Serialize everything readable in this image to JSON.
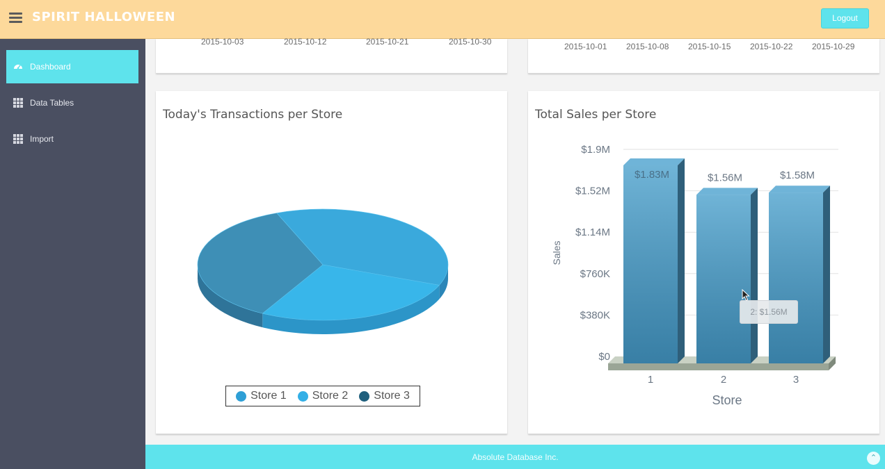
{
  "header": {
    "brand": "SPIRIT HALLOWEEN",
    "logout_label": "Logout"
  },
  "sidebar": {
    "items": [
      {
        "label": "Dashboard",
        "icon": "dashboard-icon",
        "active": true
      },
      {
        "label": "Data Tables",
        "icon": "grid-icon",
        "active": false
      },
      {
        "label": "Import",
        "icon": "grid-icon",
        "active": false
      }
    ]
  },
  "top_left_card": {
    "x_ticks": [
      "2015-10-03",
      "2015-10-12",
      "2015-10-21",
      "2015-10-30"
    ]
  },
  "top_right_card": {
    "x_ticks": [
      "2015-10-01",
      "2015-10-08",
      "2015-10-15",
      "2015-10-22",
      "2015-10-29"
    ]
  },
  "chart_data": [
    {
      "type": "pie",
      "title": "Today's Transactions per Store",
      "categories": [
        "Store 1",
        "Store 2",
        "Store 3"
      ],
      "values": [
        37,
        27,
        36
      ],
      "colors": [
        "#2e9fd6",
        "#33afe6",
        "#3a8fb8"
      ],
      "legend": "bottom"
    },
    {
      "type": "bar",
      "title": "Total Sales per Store",
      "categories": [
        "1",
        "2",
        "3"
      ],
      "values": [
        1830000,
        1560000,
        1580000
      ],
      "data_labels": [
        "$1.83M",
        "$1.56M",
        "$1.58M"
      ],
      "xlabel": "Store",
      "ylabel": "Sales",
      "y_ticks": [
        "$0",
        "$380K",
        "$760K",
        "$1.14M",
        "$1.52M",
        "$1.9M"
      ],
      "ylim": [
        0,
        1900000
      ],
      "grid": true,
      "color": "#3f88ae"
    }
  ],
  "tooltip": {
    "text": "2: $1.56M"
  },
  "footer": {
    "text": "Absolute Database Inc.",
    "scroll_icon": "chevron-up-icon",
    "scroll_symbol": "⌃"
  }
}
